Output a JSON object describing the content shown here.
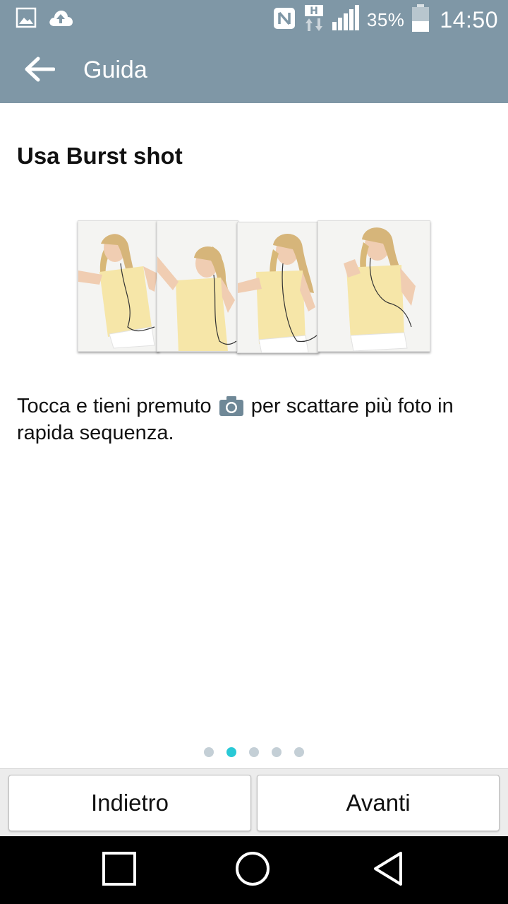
{
  "status_bar": {
    "icons_left": [
      "image-icon",
      "cloud-upload-icon"
    ],
    "icons_right": [
      "nfc-icon",
      "hspa-icon",
      "signal-icon"
    ],
    "battery_percent": "35%",
    "time": "14:50"
  },
  "header": {
    "back_icon": "arrow-left-icon",
    "title": "Guida",
    "color": "#7f97a6"
  },
  "content": {
    "title": "Usa Burst shot",
    "illustration": "burst-shot-photo-sequence",
    "description_before": "Tocca e tieni premuto ",
    "description_icon": "camera-icon",
    "description_after": " per scattare più foto in rapida sequenza."
  },
  "pager": {
    "total": 5,
    "active_index": 1,
    "active_color": "#29c9d6"
  },
  "buttons": {
    "back_label": "Indietro",
    "next_label": "Avanti"
  },
  "nav_bar": {
    "recents_icon": "square-icon",
    "home_icon": "circle-icon",
    "back_icon": "triangle-back-icon"
  }
}
